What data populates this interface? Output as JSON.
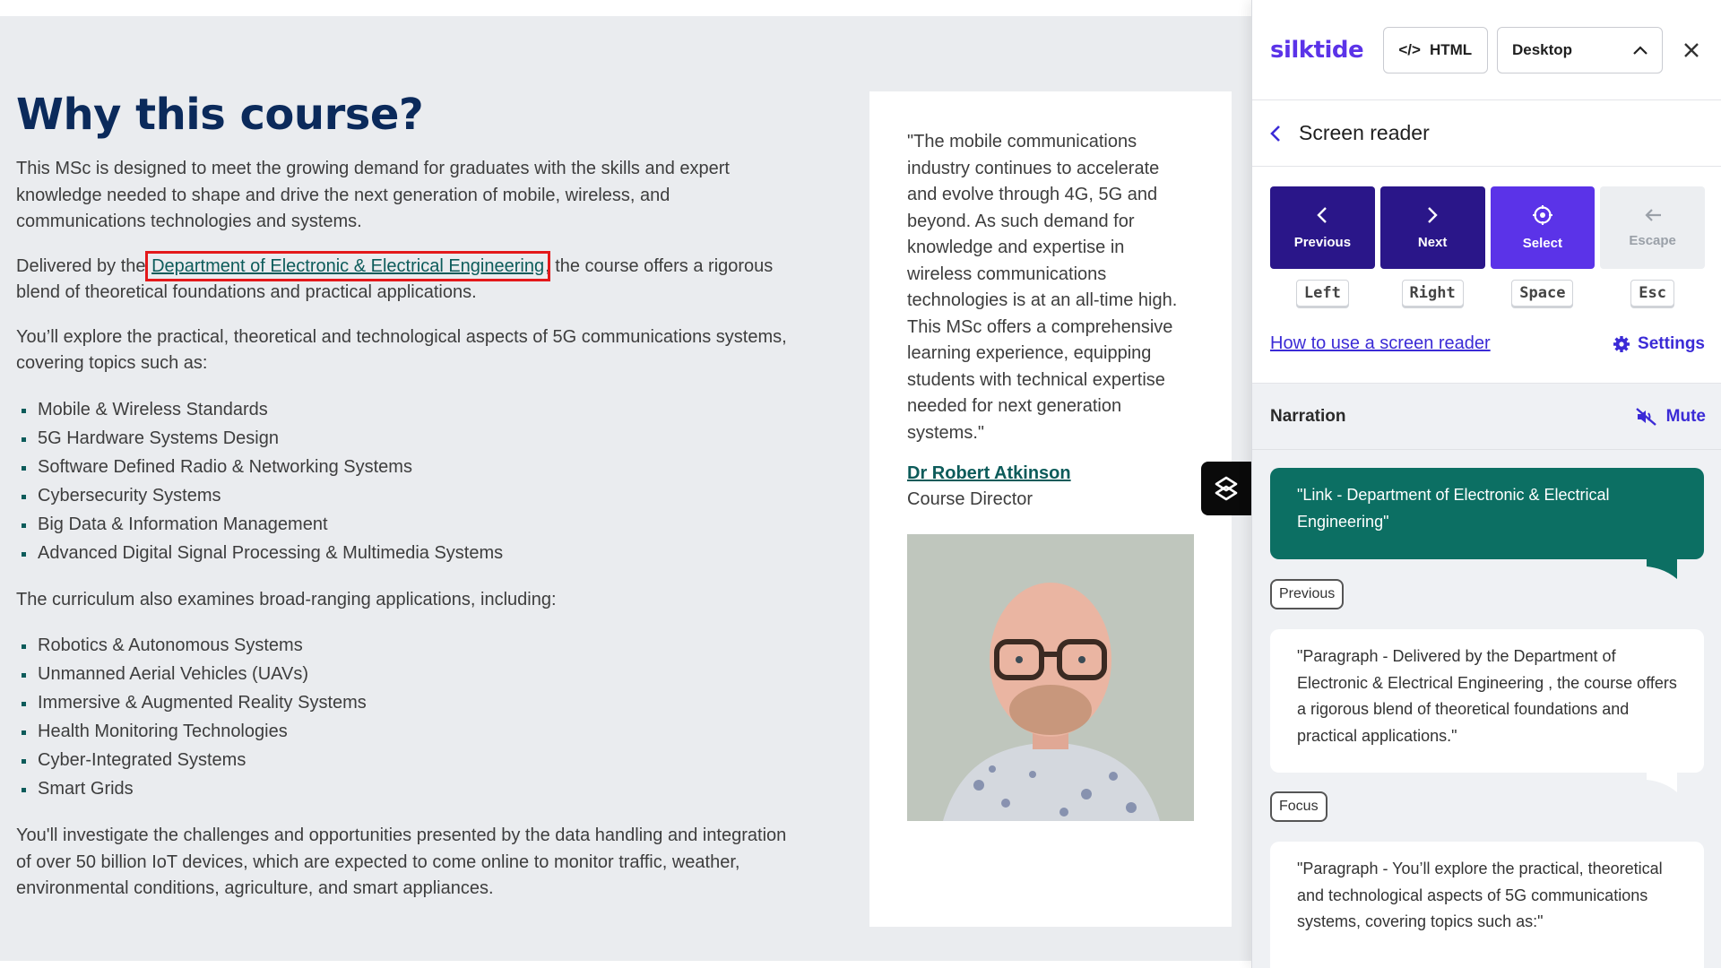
{
  "site": {
    "heading": "Why this course?",
    "para1": "This MSc is designed to meet the growing demand for graduates with the skills and expert knowledge needed to shape and drive the next generation of mobile, wireless, and communications technologies and systems.",
    "para2_before": "Delivered by the ",
    "para2_link": "Department of Electronic & Electrical Engineering",
    "para2_after": ", the course offers a rigorous blend of theoretical foundations and practical applications.",
    "para3": "You’ll explore the practical, theoretical and technological aspects of 5G communications systems, covering topics such as:",
    "topics": [
      "Mobile & Wireless Standards",
      "5G Hardware Systems Design",
      "Software Defined Radio & Networking Systems",
      "Cybersecurity Systems",
      "Big Data & Information Management",
      "Advanced Digital Signal Processing & Multimedia Systems"
    ],
    "para4": "The curriculum also examines broad-ranging applications, including:",
    "applications": [
      "Robotics & Autonomous Systems",
      "Unmanned Aerial Vehicles (UAVs)",
      "Immersive & Augmented Reality Systems",
      "Health Monitoring Technologies",
      "Cyber-Integrated Systems",
      "Smart Grids"
    ],
    "para5": "You'll investigate the challenges and opportunities presented by the data handling and integration of over 50 billion IoT devices, which are expected to come online to monitor traffic, weather, environmental conditions, agriculture, and smart appliances.",
    "quote": "\"The mobile communications industry continues to accelerate and evolve through 4G, 5G and beyond. As such demand for knowledge and expertise in wireless communications technologies is at an all-time high. This MSc offers a comprehensive learning experience, equipping students with technical expertise needed for next generation systems.\"",
    "author": "Dr Robert Atkinson",
    "role": "Course Director"
  },
  "panel": {
    "brand": "silktide",
    "html_button": "HTML",
    "device": "Desktop",
    "title": "Screen reader",
    "controls": [
      {
        "label": "Previous",
        "key": "Left"
      },
      {
        "label": "Next",
        "key": "Right"
      },
      {
        "label": "Select",
        "key": "Space"
      },
      {
        "label": "Escape",
        "key": "Esc"
      }
    ],
    "how_link": "How to use a screen reader",
    "settings": "Settings",
    "narration_label": "Narration",
    "mute": "Mute",
    "bubble_active": "\"Link - Department of Electronic & Electrical Engineering\"",
    "tag_previous": "Previous",
    "bubble_previous": "\"Paragraph - Delivered by the  Department of Electronic & Electrical Engineering , the course offers a rigorous blend of theoretical foundations and practical applications.\"",
    "tag_focus": "Focus",
    "bubble_focus": "\"Paragraph - You’ll explore the practical, theoretical and technological aspects of 5G communications systems, covering topics such as:\""
  },
  "colors": {
    "brand_purple": "#5b33e8",
    "button_dark": "#2a1689",
    "link_teal": "#0c5b5a",
    "active_bubble": "#0c6f63",
    "focus_outline": "#e3191b",
    "heading_navy": "#0b2a5b"
  }
}
